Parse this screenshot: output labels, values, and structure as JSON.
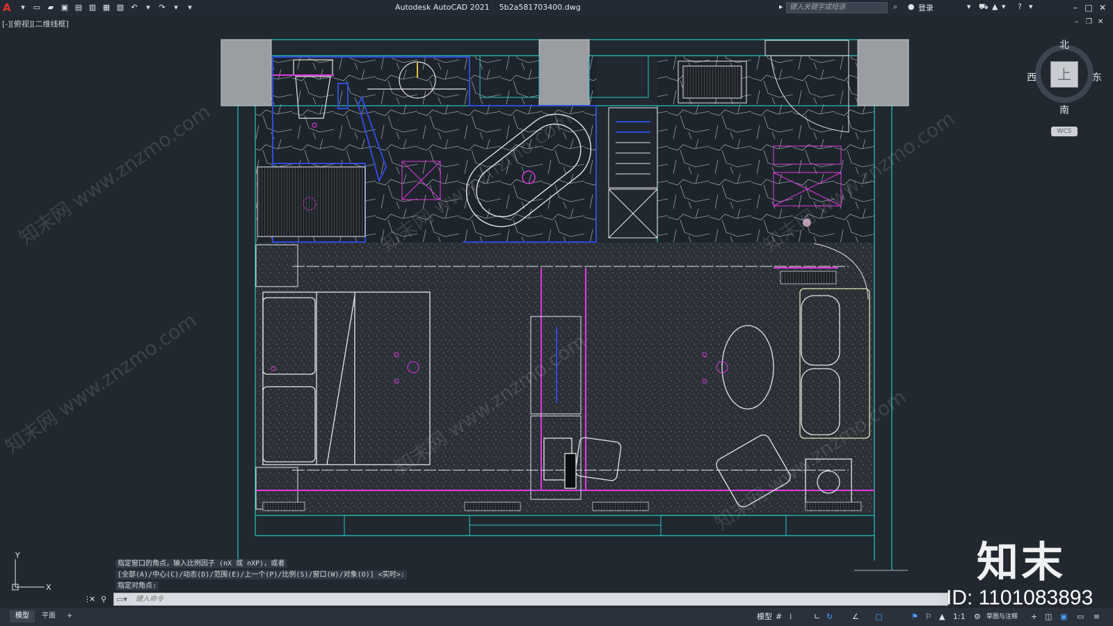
{
  "titlebar": {
    "logo": "A",
    "title": "Autodesk AutoCAD 2021",
    "filename": "5b2a581703400.dwg",
    "search_placeholder": "键入关键字或短语",
    "login": "登录",
    "qat_icons": [
      "new-icon",
      "open-icon",
      "save-icon",
      "saveas-icon",
      "publish-icon",
      "plot-preview-icon",
      "print-icon",
      "undo-icon",
      "redo-icon",
      "customize-icon"
    ]
  },
  "viewport": {
    "label": "[-][俯视][二维线框]"
  },
  "viewcube": {
    "north": "北",
    "south": "南",
    "east": "东",
    "west": "西",
    "face": "上",
    "wcs": "WCS"
  },
  "command": {
    "history": [
      "指定窗口的角点，输入比例因子 (nX 或 nXP)，或者",
      "[全部(A)/中心(C)/动态(D)/范围(E)/上一个(P)/比例(S)/窗口(W)/对象(O)] <实时>:",
      "指定对角点:"
    ],
    "placeholder": "键入命令"
  },
  "statusbar": {
    "tabs": [
      "模型",
      "平面"
    ],
    "add_tab": "+",
    "model_label": "模型",
    "scale": "1:1",
    "workspace": "草图与注释"
  },
  "ucs": {
    "x": "X",
    "y": "Y"
  },
  "overlay": {
    "brand": "知末",
    "id": "ID: 1101083893",
    "watermark": "知末网 www.znzmo.com"
  },
  "colors": {
    "background": "#212830",
    "cyan": "#29c4c4",
    "magenta": "#e23ae2",
    "blue": "#2f4bdc",
    "wall_gray": "#9a9ea3",
    "green": "#2ec72e"
  }
}
